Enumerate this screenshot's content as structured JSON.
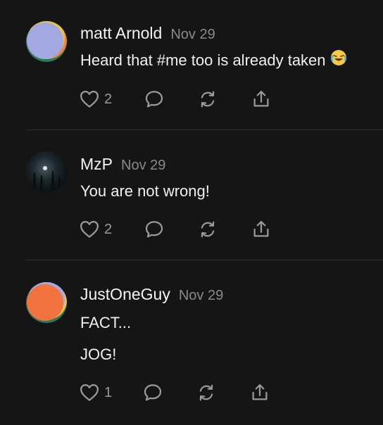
{
  "comments": [
    {
      "author": "matt Arnold",
      "date": "Nov 29",
      "lines": [
        "Heard that #me too is already taken"
      ],
      "emoji": "crying-laughing-emoji",
      "likes": "2"
    },
    {
      "author": "MzP",
      "date": "Nov 29",
      "lines": [
        "You are not wrong!"
      ],
      "likes": "2"
    },
    {
      "author": "JustOneGuy",
      "date": "Nov 29",
      "lines": [
        "FACT...",
        "JOG!"
      ],
      "likes": "1"
    }
  ],
  "icons": {
    "like": "heart-icon",
    "reply": "speech-bubble-icon",
    "restack": "refresh-icon",
    "share": "share-icon"
  },
  "colors": {
    "background": "#151515",
    "muted": "#8a8a8a",
    "icon": "#9a9a9a",
    "avatar1_primary": "#a3a8e3",
    "avatar3_primary": "#f2733f"
  }
}
